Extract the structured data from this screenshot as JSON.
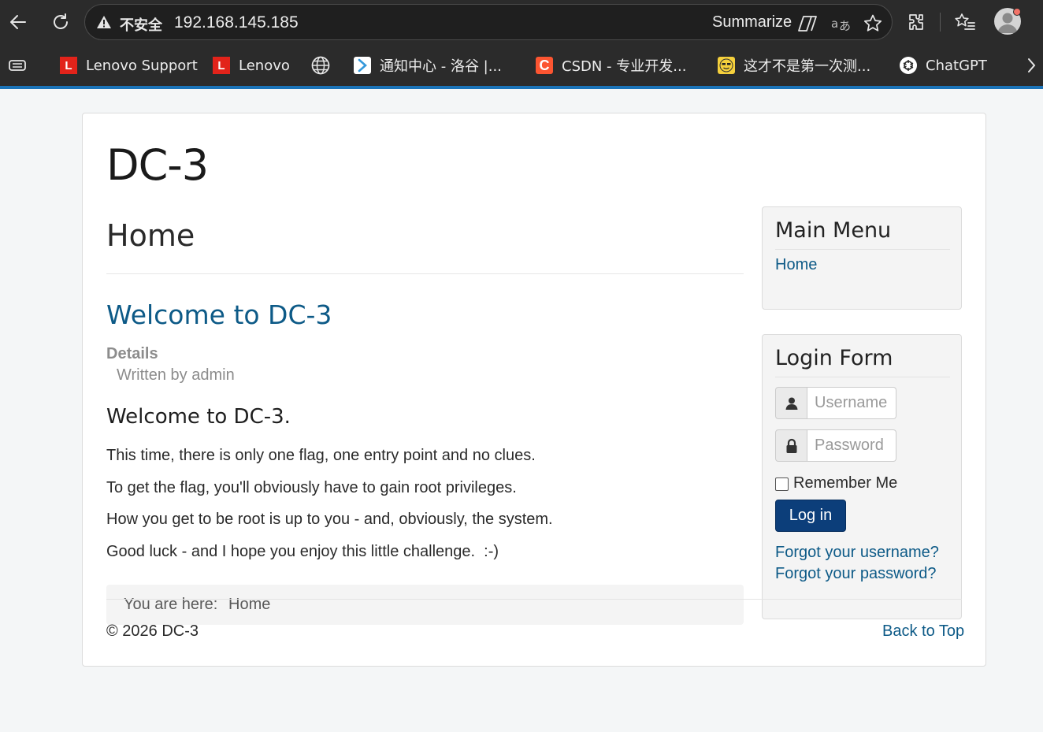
{
  "browser": {
    "insecure_label": "不安全",
    "url": "192.168.145.185",
    "summarize_label": "Summarize"
  },
  "bookmarks": [
    {
      "label": "Lenovo Support",
      "icon": "lenovo-icon",
      "color": "#e2231a"
    },
    {
      "label": "Lenovo",
      "icon": "lenovo-icon",
      "color": "#e2231a"
    },
    {
      "label": "",
      "icon": "globe-icon",
      "color": "#ececec"
    },
    {
      "label": "通知中心 - 洛谷 |...",
      "icon": "luogu-icon",
      "color": "#3498db"
    },
    {
      "label": "CSDN - 专业开发...",
      "icon": "csdn-icon",
      "color": "#fc5531"
    },
    {
      "label": "这才不是第一次测...",
      "icon": "emoji-icon",
      "color": "#f5d03c"
    },
    {
      "label": "ChatGPT",
      "icon": "chatgpt-icon",
      "color": "#ffffff"
    }
  ],
  "site": {
    "title": "DC-3"
  },
  "content": {
    "page_heading": "Home",
    "article_title": "Welcome to DC-3",
    "details_label": "Details",
    "written_by": "Written by admin",
    "subheading": "Welcome to DC-3.",
    "paragraphs": [
      "This time, there is only one flag, one entry point and no clues.",
      "To get the flag, you'll obviously have to gain root privileges.",
      "How you get to be root is up to you - and, obviously, the system.",
      "Good luck - and I hope you enjoy this little challenge.  :-)"
    ],
    "breadcrumb_label": "You are here:",
    "breadcrumb_home": "Home"
  },
  "main_menu": {
    "title": "Main Menu",
    "items": [
      "Home"
    ]
  },
  "login_form": {
    "title": "Login Form",
    "username_placeholder": "Username",
    "password_placeholder": "Password",
    "remember_label": "Remember Me",
    "login_label": "Log in",
    "forgot_username": "Forgot your username?",
    "forgot_password": "Forgot your password?"
  },
  "footer": {
    "copyright": "© 2026 DC-3",
    "back_to_top": "Back to Top"
  },
  "colors": {
    "link": "#0d5a87",
    "button": "#0c3e7a",
    "accent_bar": "#1a73b8"
  }
}
